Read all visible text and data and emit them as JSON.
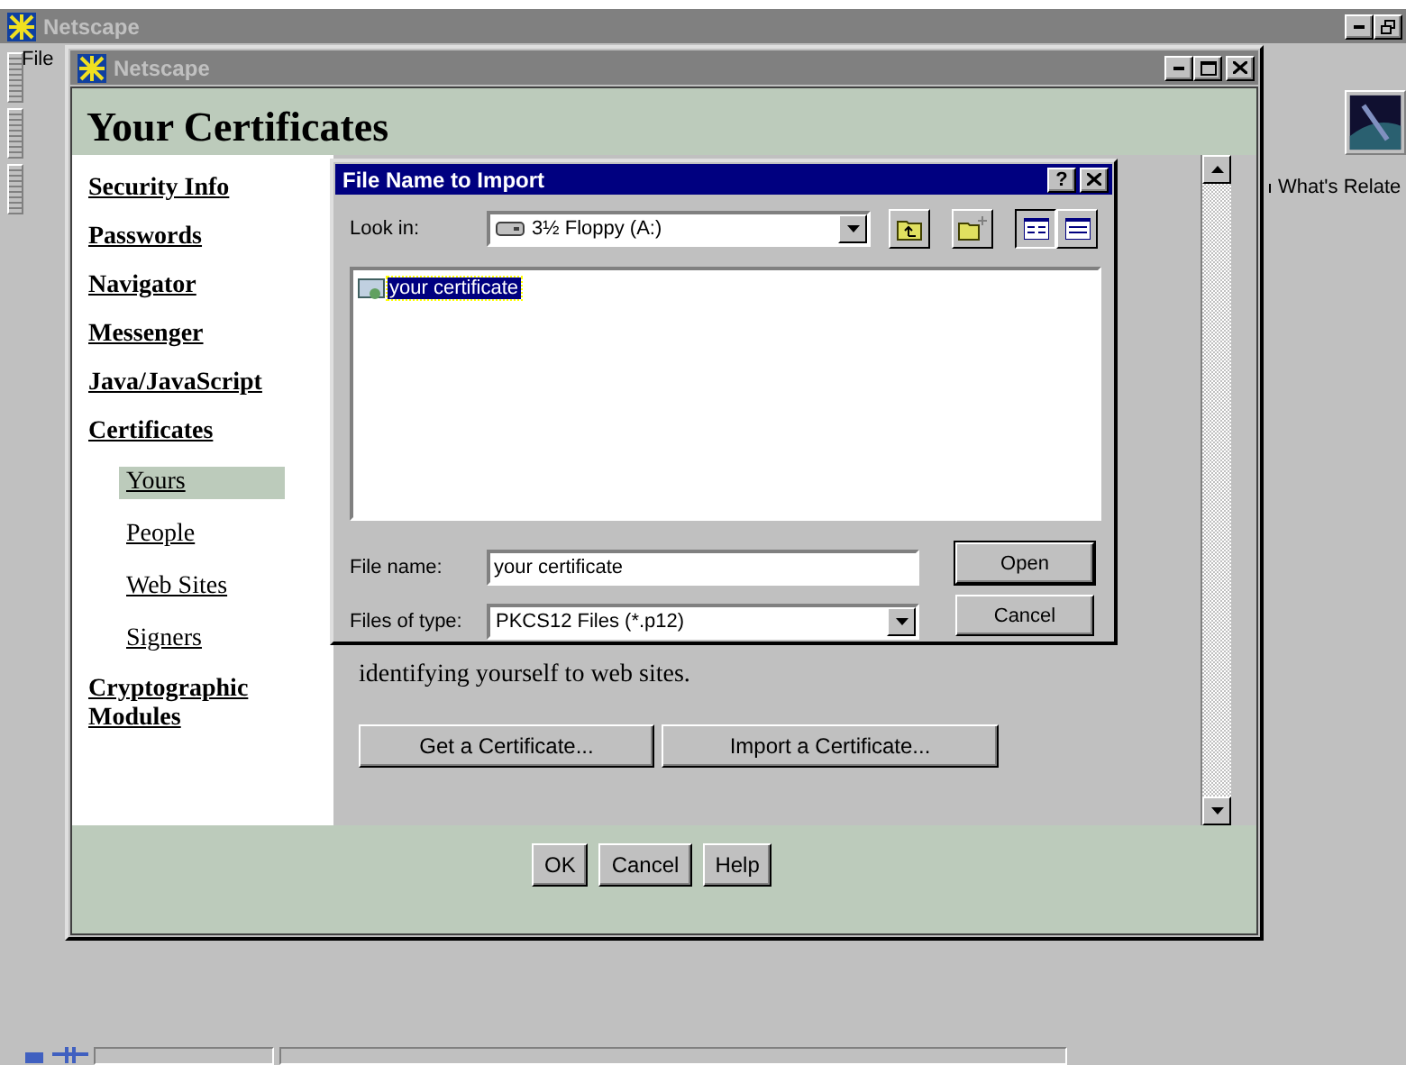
{
  "outer_window": {
    "title": "Netscape",
    "menu": [
      "File"
    ],
    "toolbar_label": "What's Relate"
  },
  "window": {
    "title": "Netscape",
    "heading": "Your Certificates",
    "sidebar": [
      {
        "label": "Security Info",
        "selected": false
      },
      {
        "label": "Passwords",
        "selected": false
      },
      {
        "label": "Navigator",
        "selected": false
      },
      {
        "label": "Messenger",
        "selected": false
      },
      {
        "label": "Java/JavaScript",
        "selected": false
      },
      {
        "label": "Certificates",
        "selected": false,
        "children": [
          {
            "label": "Yours",
            "selected": true
          },
          {
            "label": "People",
            "selected": false
          },
          {
            "label": "Web Sites",
            "selected": false
          },
          {
            "label": "Signers",
            "selected": false
          }
        ]
      },
      {
        "label": "Cryptographic Modules",
        "selected": false
      }
    ],
    "content": {
      "text": "identifying yourself to web sites.",
      "buttons": [
        "Get a Certificate...",
        "Import a Certificate..."
      ]
    },
    "buttons": [
      "OK",
      "Cancel",
      "Help"
    ]
  },
  "dialog": {
    "title": "File Name to Import",
    "help_button": "?",
    "look_in": {
      "label": "Look in:",
      "value": "3½ Floppy (A:)"
    },
    "files": [
      {
        "name": "your certificate",
        "selected": true
      }
    ],
    "file_name": {
      "label": "File name:",
      "value": "your certificate"
    },
    "file_type": {
      "label": "Files of type:",
      "value": "PKCS12 Files (*.p12)"
    },
    "buttons": [
      "Open",
      "Cancel"
    ]
  }
}
